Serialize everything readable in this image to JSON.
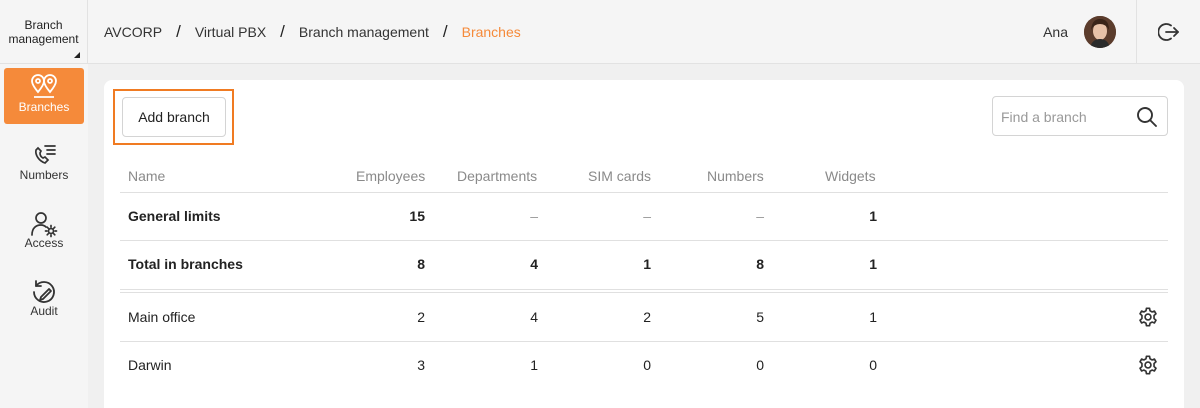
{
  "app_switch": {
    "label": "Branch management"
  },
  "breadcrumb": [
    "AVCORP",
    "Virtual PBX",
    "Branch management",
    "Branches"
  ],
  "user": {
    "name": "Ana"
  },
  "sidebar": {
    "items": [
      {
        "label": "Branches",
        "active": true,
        "icon": "map-pin-icon"
      },
      {
        "label": "Numbers",
        "active": false,
        "icon": "phone-list-icon"
      },
      {
        "label": "Access",
        "active": false,
        "icon": "user-gear-icon"
      },
      {
        "label": "Audit",
        "active": false,
        "icon": "audit-icon"
      }
    ]
  },
  "toolbar": {
    "add_label": "Add branch",
    "search_placeholder": "Find a branch"
  },
  "table": {
    "headers": [
      "Name",
      "Employees",
      "Departments",
      "SIM cards",
      "Numbers",
      "Widgets"
    ],
    "summary": [
      {
        "name": "General limits",
        "employees": "15",
        "departments": "–",
        "sim_cards": "–",
        "numbers": "–",
        "widgets": "1"
      },
      {
        "name": "Total in branches",
        "employees": "8",
        "departments": "4",
        "sim_cards": "1",
        "numbers": "8",
        "widgets": "1"
      }
    ],
    "rows": [
      {
        "name": "Main office",
        "employees": "2",
        "departments": "4",
        "sim_cards": "2",
        "numbers": "5",
        "widgets": "1"
      },
      {
        "name": "Darwin",
        "employees": "3",
        "departments": "1",
        "sim_cards": "0",
        "numbers": "0",
        "widgets": "0"
      }
    ]
  },
  "colors": {
    "accent": "#f58a3a",
    "highlight": "#f07b22"
  }
}
